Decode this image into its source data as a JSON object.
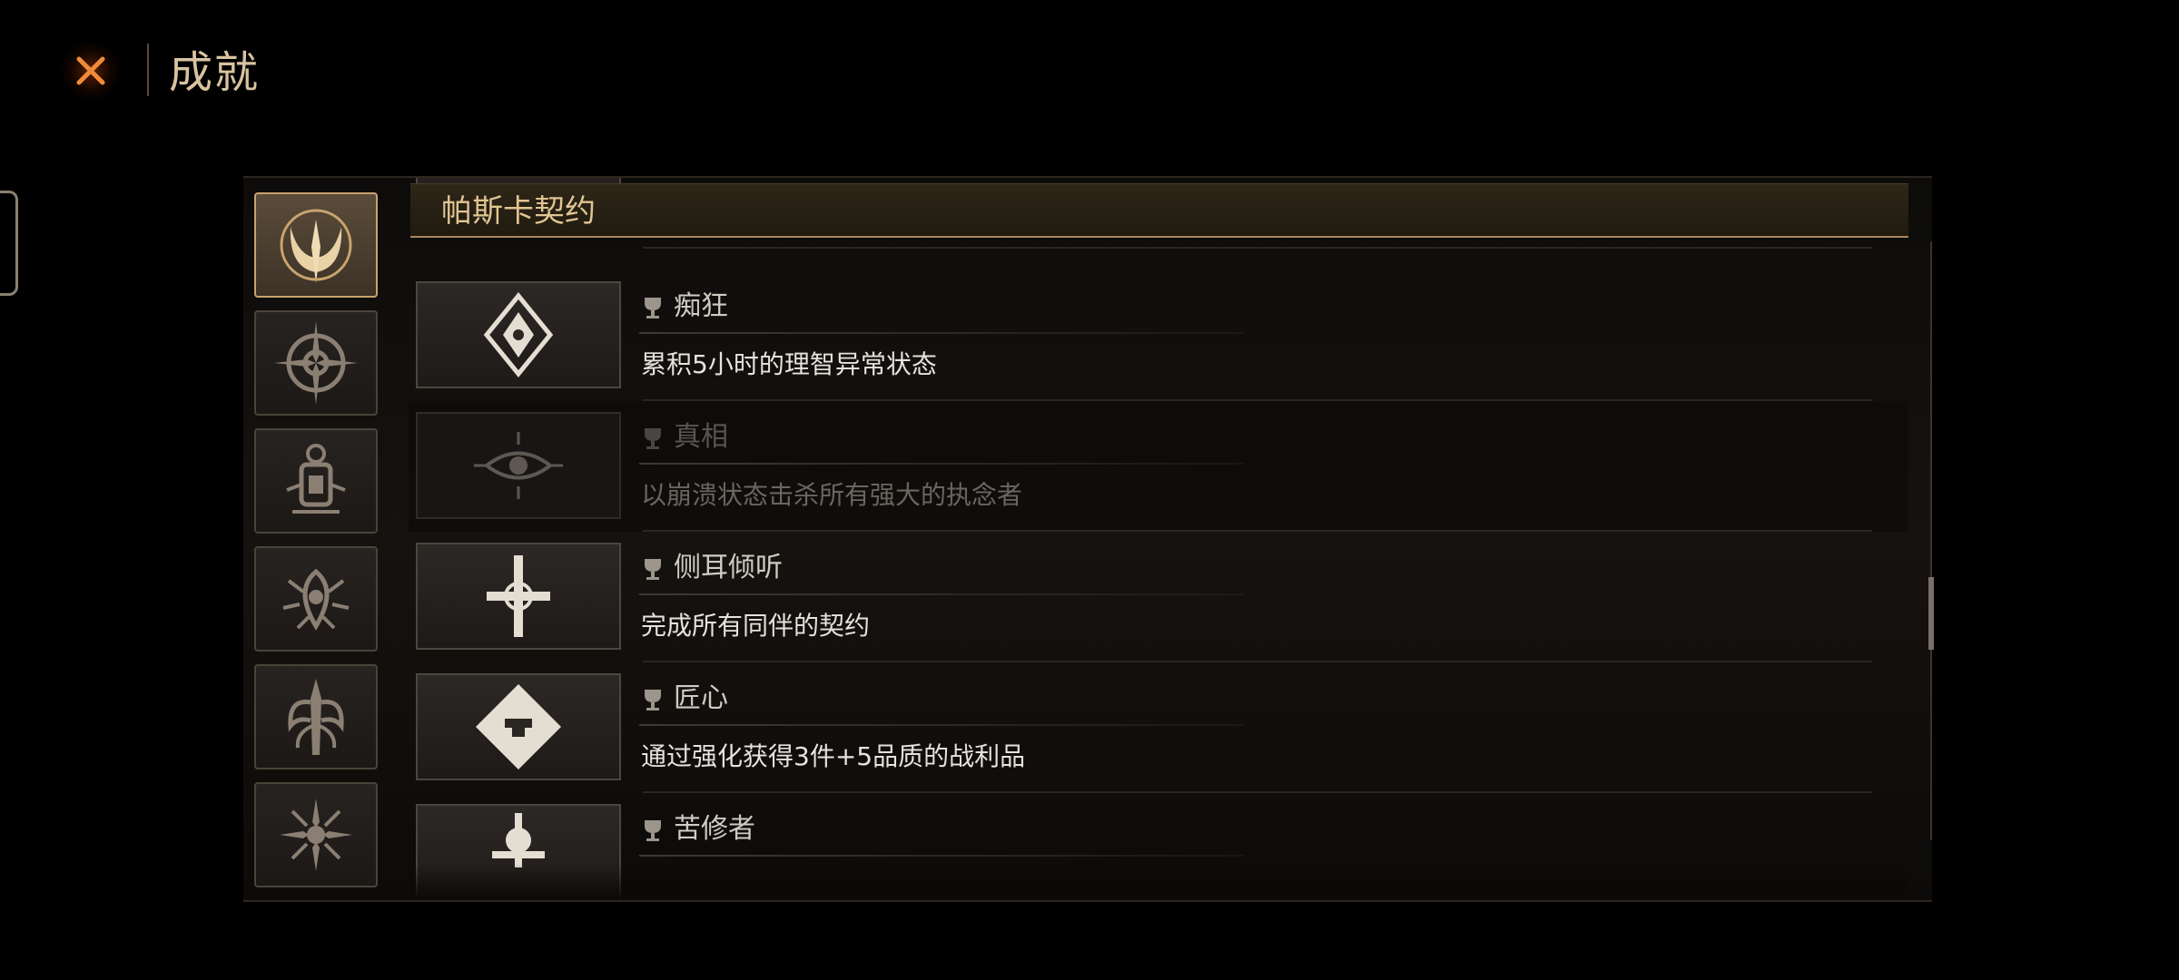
{
  "header": {
    "title": "成就",
    "close_icon": "close-x-icon",
    "accent_color": "#e06a20"
  },
  "side_nav": {
    "tabs": [
      {
        "name": "horned-moon-emblem-icon",
        "active": true
      },
      {
        "name": "compass-gear-emblem-icon",
        "active": false
      },
      {
        "name": "lantern-emblem-icon",
        "active": false
      },
      {
        "name": "spiked-eye-emblem-icon",
        "active": false
      },
      {
        "name": "tentacle-emblem-icon",
        "active": false
      },
      {
        "name": "sun-ornament-emblem-icon",
        "active": false
      }
    ]
  },
  "category": {
    "title": "帕斯卡契约"
  },
  "achievements": [
    {
      "title": "痴狂",
      "description": "累积5小时的理智异常状态",
      "icon": "ornate-diamond-icon",
      "status": "completed-star-icon",
      "locked": false
    },
    {
      "title": "真相",
      "description": "以崩溃状态击杀所有强大的执念者",
      "icon": "all-seeing-eye-icon",
      "status": "locked-eye-icon",
      "locked": true
    },
    {
      "title": "侧耳倾听",
      "description": "完成所有同伴的契约",
      "icon": "cross-sigil-icon",
      "status": "completed-star-icon",
      "locked": false
    },
    {
      "title": "匠心",
      "description": "通过强化获得3件+5品质的战利品",
      "icon": "anvil-diamond-icon",
      "status": "completed-star-icon",
      "locked": false
    },
    {
      "title": "苦修者",
      "description": "",
      "icon": "shrine-icon",
      "status": "completed-star-icon",
      "locked": false
    }
  ]
}
